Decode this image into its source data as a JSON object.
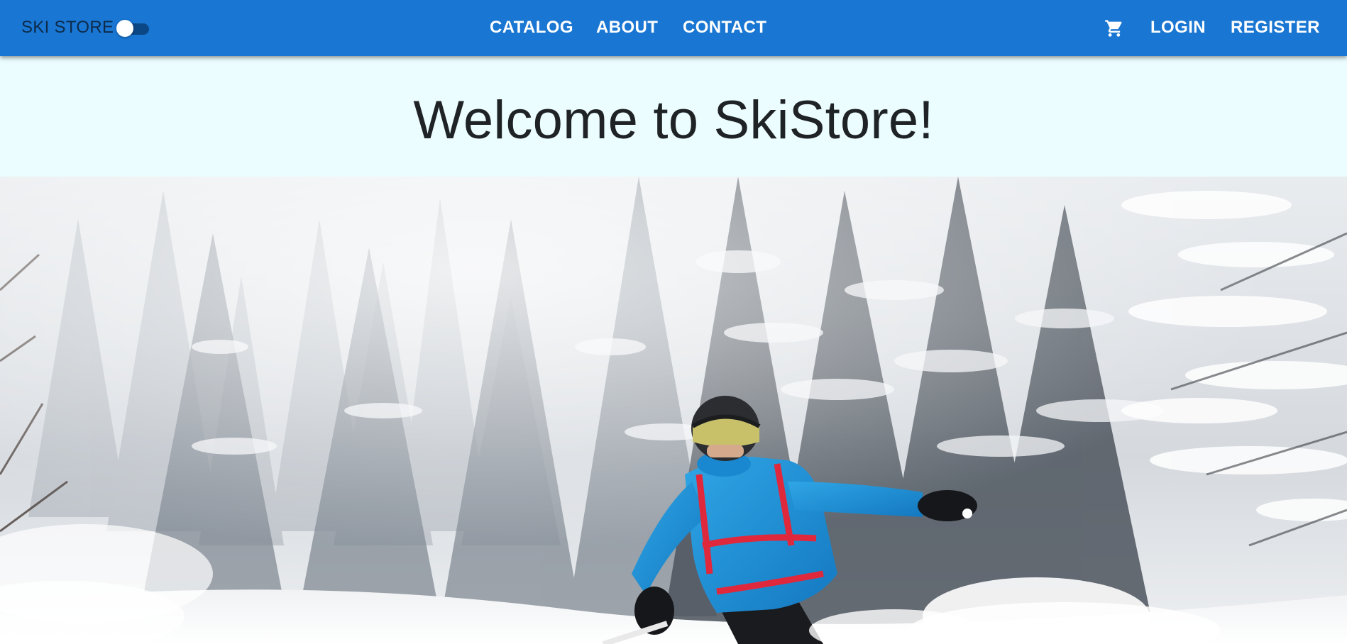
{
  "brand": {
    "name": "SKI STORE"
  },
  "theme_toggle": {
    "state": "off"
  },
  "nav": {
    "catalog": "CATALOG",
    "about": "ABOUT",
    "contact": "CONTACT",
    "login": "LOGIN",
    "register": "REGISTER"
  },
  "icons": {
    "cart": "shopping-cart-icon"
  },
  "colors": {
    "appbar": "#1976d2",
    "page_background": "#ebfdff",
    "brand_text": "#0d2a4a"
  },
  "hero": {
    "title": "Welcome to SkiStore!"
  }
}
